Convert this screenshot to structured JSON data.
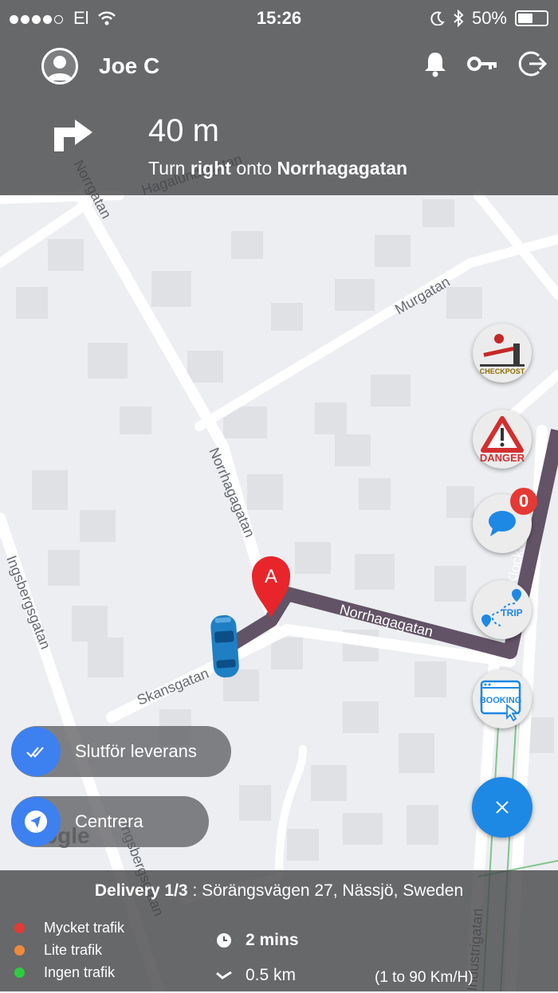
{
  "status_bar": {
    "carrier": "El",
    "time": "15:26",
    "battery": "50%"
  },
  "user": {
    "name": "Joe C"
  },
  "navigation": {
    "distance": "40 m",
    "instruction_prefix": "Turn",
    "instruction_direction": "right",
    "instruction_mid": "onto",
    "instruction_street": "Norrhagagatan"
  },
  "map": {
    "streets": [
      "Norrgatan",
      "Hagalundsgatan",
      "Murgatan",
      "Norrhagagatan",
      "Ingsbergsgatan",
      "Skansgatan",
      "Norrhagagatan",
      "Klockaregatan",
      "Ingsbergsgatan",
      "Industrigatan"
    ],
    "marker_label": "A",
    "route_color": "#5b4a5e"
  },
  "actions": {
    "checkpost_label": "CHECKPOST",
    "danger_label": "DANGER",
    "messages_badge": "0",
    "trip_label": "TRIP",
    "booking_label": "BOOKING"
  },
  "buttons": {
    "finish_delivery": "Slutför leverans",
    "center": "Centrera"
  },
  "bottom": {
    "delivery_label": "Delivery 1/3",
    "delivery_address": " : Sörängsvägen 27, Nässjö, Sweden",
    "legend": [
      {
        "label": "Mycket trafik",
        "color": "#e53935"
      },
      {
        "label": "Lite trafik",
        "color": "#f0883a"
      },
      {
        "label": "Ingen trafik",
        "color": "#2ecc40"
      }
    ],
    "duration": "2 mins",
    "distance": "0.5 km",
    "speed_range": "(1 to 90 Km/H)"
  }
}
